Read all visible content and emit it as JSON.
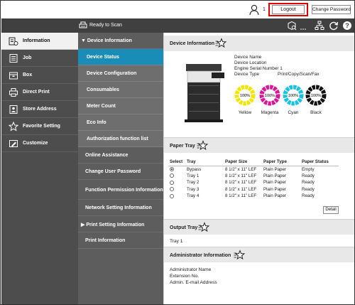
{
  "topbar": {
    "user_count": "1",
    "logout_label": "Logout",
    "change_password_label": "Change Password"
  },
  "toolbar": {
    "status_text": "Ready to Scan"
  },
  "left_nav": {
    "items": [
      {
        "label": "Information",
        "icon": "info-icon",
        "active": true
      },
      {
        "label": "Job",
        "icon": "job-icon"
      },
      {
        "label": "Box",
        "icon": "box-icon"
      },
      {
        "label": "Direct Print",
        "icon": "direct-print-icon"
      },
      {
        "label": "Store Address",
        "icon": "address-book-icon"
      },
      {
        "label": "Favorite Setting",
        "icon": "star-icon"
      },
      {
        "label": "Customize",
        "icon": "customize-icon"
      }
    ]
  },
  "sub_nav": {
    "header": "Device Information",
    "children": [
      "Device Status",
      "Device Configuration",
      "Consumables",
      "Meter Count",
      "Eco Info",
      "Authorization function list"
    ],
    "selected": "Device Status",
    "others": [
      "Online Assistance",
      "Change User Password",
      "Function Permission Information",
      "Network Setting Information",
      "Print Setting Information",
      "Print Information"
    ]
  },
  "device_info": {
    "title": "Device Information",
    "fields": [
      "Device Name",
      "Device Location",
      "Engine Serial Number 1",
      "Device Type"
    ],
    "device_name": "",
    "device_type": "Print/Copy/Scan/Fax",
    "toner": [
      {
        "label": "Yellow",
        "percent": "100%",
        "color": "#f2e600"
      },
      {
        "label": "Magenta",
        "percent": "100%",
        "color": "#e0129a"
      },
      {
        "label": "Cyan",
        "percent": "100%",
        "color": "#14c3e6"
      },
      {
        "label": "Black",
        "percent": "100%",
        "color": "#111111"
      }
    ]
  },
  "paper_tray": {
    "title": "Paper Tray",
    "columns": [
      "Select",
      "Tray",
      "Paper Size",
      "Paper Type",
      "Paper Status"
    ],
    "rows": [
      {
        "tray": "Bypass",
        "size": "8 1/2\" x 11\" LEF",
        "type": "Plain Paper",
        "status": "Empty",
        "selected": true
      },
      {
        "tray": "Tray 1",
        "size": "8 1/2\" x 11\" LEF",
        "type": "Plain Paper",
        "status": "Ready"
      },
      {
        "tray": "Tray 2",
        "size": "8 1/2\" x 11\" LEF",
        "type": "Plain Paper",
        "status": "Ready"
      },
      {
        "tray": "Tray 3",
        "size": "8 1/2\" x 11\" LEF",
        "type": "Plain Paper",
        "status": "Ready"
      },
      {
        "tray": "Tray 4",
        "size": "8 1/2\" x 11\" LEF",
        "type": "Plain Paper",
        "status": "Ready"
      }
    ],
    "detail_label": "Detail"
  },
  "output_tray": {
    "title": "Output Tray",
    "value": "Tray 1"
  },
  "admin_info": {
    "title": "Administrator Information",
    "fields": [
      "Administrator Name",
      "Extension No.",
      "Admin. E-mail Address"
    ]
  },
  "colors": {
    "selected_subnav": "#1a8cb8",
    "logout_highlight": "#e00000"
  }
}
